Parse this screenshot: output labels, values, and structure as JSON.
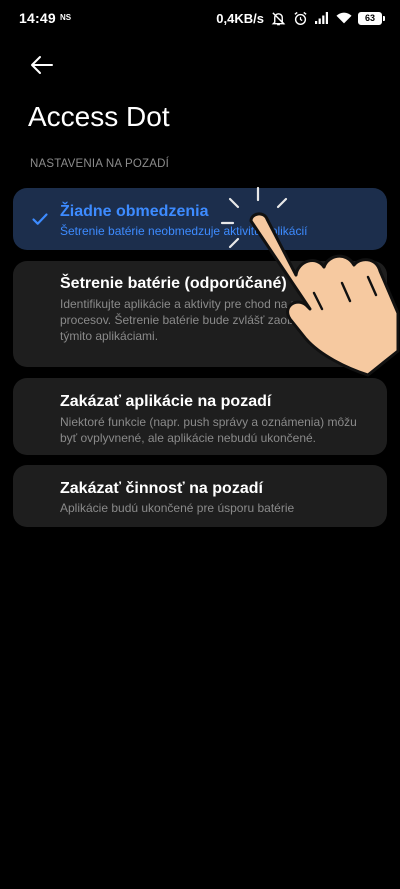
{
  "status_bar": {
    "time": "14:49",
    "carrier_badge": "NS",
    "net_speed": "0,4KB/s",
    "battery_level": "63",
    "icons": [
      "mute-icon",
      "alarm-icon",
      "signal-icon",
      "wifi-icon",
      "battery-icon"
    ]
  },
  "header": {
    "back_icon": "arrow-left-icon",
    "title": "Access Dot"
  },
  "section": {
    "header": "NASTAVENIA NA POZADÍ"
  },
  "options": [
    {
      "title": "Žiadne obmedzenia",
      "desc": "Šetrenie batérie neobmedzuje aktivitu aplikácií",
      "selected": true
    },
    {
      "title": "Šetrenie batérie (odporúčané)",
      "desc": "Identifikujte aplikácie a aktivity pre chod na pozadí procesov. Šetrenie batérie bude zvlášť zaobchádzať s týmito aplikáciami.",
      "selected": false
    },
    {
      "title": "Zakázať aplikácie na pozadí",
      "desc": "Niektoré funkcie (napr. push správy a oznámenia) môžu byť ovplyvnené, ale aplikácie nebudú ukončené.",
      "selected": false
    },
    {
      "title": "Zakázať činnosť na pozadí",
      "desc": "Aplikácie budú ukončené pre úsporu batérie",
      "selected": false
    }
  ],
  "colors": {
    "background": "#000000",
    "card": "#1e1e1e",
    "selected_card": "#1c2e4c",
    "accent": "#3d8bff",
    "secondary_text": "#8a8a8a"
  },
  "overlay": {
    "icon": "tap-hand-icon"
  }
}
